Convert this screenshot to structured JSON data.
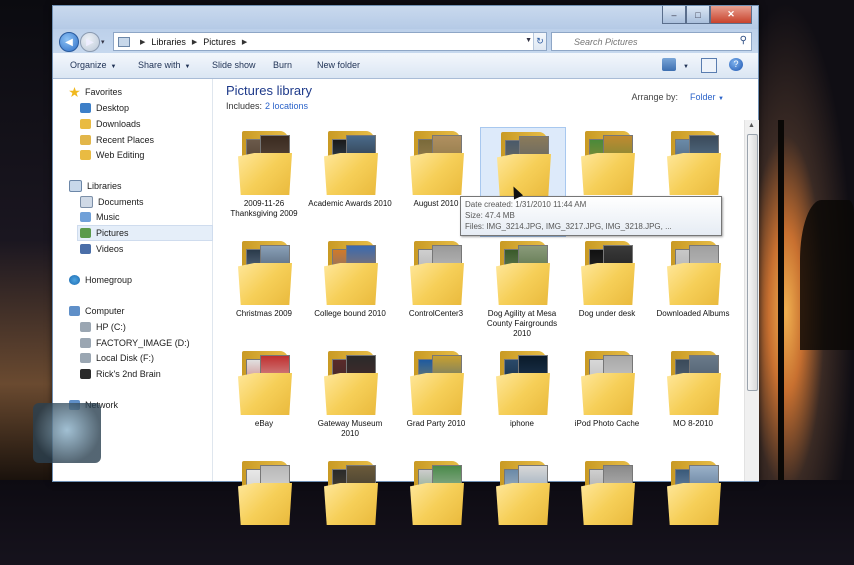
{
  "window": {
    "buttons": {
      "minimize": "–",
      "maximize": "□",
      "close": "✕"
    }
  },
  "address": {
    "crumbs": [
      "Libraries",
      "Pictures"
    ],
    "search_placeholder": "Search Pictures"
  },
  "toolbar": {
    "organize": "Organize",
    "share_with": "Share with",
    "slide_show": "Slide show",
    "burn": "Burn",
    "new_folder": "New folder"
  },
  "sidebar": {
    "favorites": {
      "label": "Favorites",
      "items": [
        "Desktop",
        "Downloads",
        "Recent Places",
        "Web Editing"
      ]
    },
    "libraries": {
      "label": "Libraries",
      "items": [
        "Documents",
        "Music",
        "Pictures",
        "Videos"
      ]
    },
    "homegroup": "Homegroup",
    "computer": {
      "label": "Computer",
      "items": [
        "HP (C:)",
        "FACTORY_IMAGE (D:)",
        "Local Disk (F:)",
        "Rick's 2nd Brain"
      ]
    },
    "network": "Network"
  },
  "library": {
    "title": "Pictures library",
    "includes_label": "Includes:",
    "includes_link": "2 locations",
    "arrange_label": "Arrange by:",
    "arrange_value": "Folder"
  },
  "folders": [
    {
      "label": "2009-11-26 Thanksgiving 2009"
    },
    {
      "label": "Academic Awards 2010"
    },
    {
      "label": "August 2010"
    },
    {
      "label": "Ba..."
    },
    {
      "label": ""
    },
    {
      "label": ""
    },
    {
      "label": "Christmas 2009"
    },
    {
      "label": "College bound 2010"
    },
    {
      "label": "ControlCenter3"
    },
    {
      "label": "Dog Agility at Mesa County Fairgrounds 2010"
    },
    {
      "label": "Dog under desk"
    },
    {
      "label": "Downloaded Albums"
    },
    {
      "label": "eBay"
    },
    {
      "label": "Gateway Museum 2010"
    },
    {
      "label": "Grad Party 2010"
    },
    {
      "label": "iphone"
    },
    {
      "label": "iPod Photo Cache"
    },
    {
      "label": "MO 8-2010"
    },
    {
      "label": ""
    },
    {
      "label": ""
    },
    {
      "label": ""
    },
    {
      "label": ""
    },
    {
      "label": ""
    },
    {
      "label": ""
    }
  ],
  "tooltip": {
    "date_created": "Date created: 1/31/2010 11:44 AM",
    "size": "Size: 47.4 MB",
    "files": "Files: IMG_3214.JPG, IMG_3217.JPG, IMG_3218.JPG, ..."
  },
  "colors": {
    "link": "#2b63c9",
    "title": "#1e3a8a",
    "selection": "#e5eef9"
  }
}
